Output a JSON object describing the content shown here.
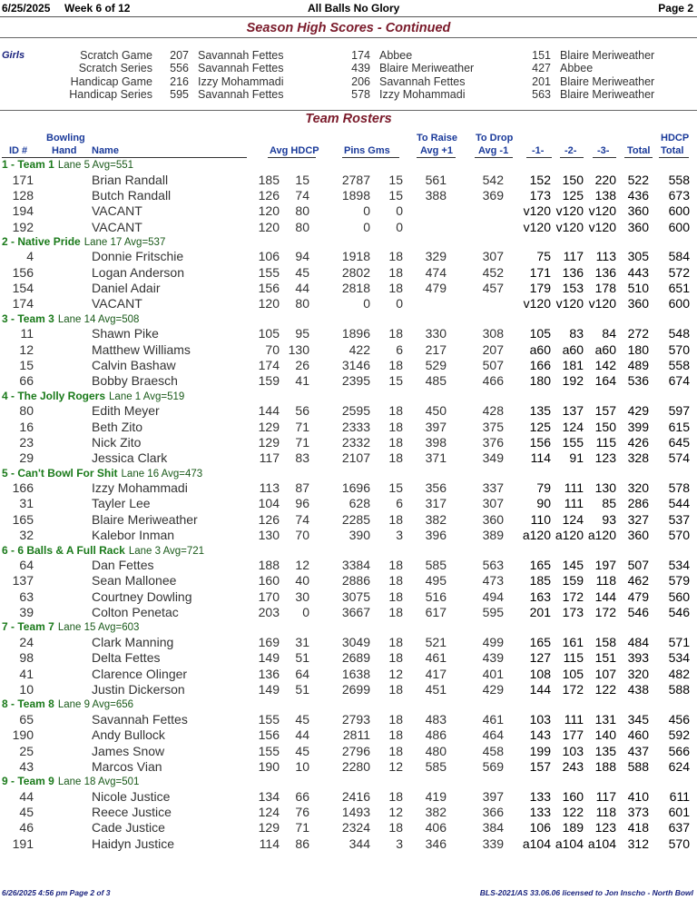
{
  "header": {
    "date": "6/25/2025",
    "week": "Week 6 of 12",
    "league": "All Balls No Glory",
    "page": "Page 2"
  },
  "high_scores": {
    "title": "Season High Scores - Continued",
    "group": "Girls",
    "rows": [
      {
        "label": "Scratch Game",
        "entries": [
          [
            "207",
            "Savannah Fettes"
          ],
          [
            "174",
            "Abbee"
          ],
          [
            "151",
            "Blaire Meriweather"
          ]
        ]
      },
      {
        "label": "Scratch Series",
        "entries": [
          [
            "556",
            "Savannah Fettes"
          ],
          [
            "439",
            "Blaire Meriweather"
          ],
          [
            "427",
            "Abbee"
          ]
        ]
      },
      {
        "label": "Handicap Game",
        "entries": [
          [
            "216",
            "Izzy Mohammadi"
          ],
          [
            "206",
            "Savannah Fettes"
          ],
          [
            "201",
            "Blaire Meriweather"
          ]
        ]
      },
      {
        "label": "Handicap Series",
        "entries": [
          [
            "595",
            "Savannah Fettes"
          ],
          [
            "578",
            "Izzy Mohammadi"
          ],
          [
            "563",
            "Blaire Meriweather"
          ]
        ]
      }
    ]
  },
  "rosters": {
    "title": "Team Rosters",
    "headers": {
      "id": "ID #",
      "bowling": "Bowling",
      "hand": "Hand",
      "name": "Name",
      "avg_hdcp": "Avg HDCP",
      "pins_gms": "Pins Gms",
      "to_raise": "To Raise",
      "avg_plus": "Avg +1",
      "to_drop": "To Drop",
      "avg_minus": "Avg -1",
      "g1": "-1-",
      "g2": "-2-",
      "g3": "-3-",
      "total": "Total",
      "hdcp": "HDCP",
      "hdcp_total": "Total"
    },
    "teams": [
      {
        "name": "1 - Team 1",
        "info": "Lane 5  Avg=551",
        "players": [
          [
            "171",
            "Brian Randall",
            "185",
            "15",
            "2787",
            "15",
            "561",
            "542",
            "152",
            "150",
            "220",
            "522",
            "558"
          ],
          [
            "128",
            "Butch Randall",
            "126",
            "74",
            "1898",
            "15",
            "388",
            "369",
            "173",
            "125",
            "138",
            "436",
            "673"
          ],
          [
            "194",
            "VACANT",
            "120",
            "80",
            "0",
            "0",
            "",
            "",
            "v120",
            "v120",
            "v120",
            "360",
            "600"
          ],
          [
            "192",
            "VACANT",
            "120",
            "80",
            "0",
            "0",
            "",
            "",
            "v120",
            "v120",
            "v120",
            "360",
            "600"
          ]
        ]
      },
      {
        "name": "2 - Native Pride",
        "info": "Lane 17  Avg=537",
        "players": [
          [
            "4",
            "Donnie Fritschie",
            "106",
            "94",
            "1918",
            "18",
            "329",
            "307",
            "75",
            "117",
            "113",
            "305",
            "584"
          ],
          [
            "156",
            "Logan Anderson",
            "155",
            "45",
            "2802",
            "18",
            "474",
            "452",
            "171",
            "136",
            "136",
            "443",
            "572"
          ],
          [
            "154",
            "Daniel Adair",
            "156",
            "44",
            "2818",
            "18",
            "479",
            "457",
            "179",
            "153",
            "178",
            "510",
            "651"
          ],
          [
            "174",
            "VACANT",
            "120",
            "80",
            "0",
            "0",
            "",
            "",
            "v120",
            "v120",
            "v120",
            "360",
            "600"
          ]
        ]
      },
      {
        "name": "3 - Team 3",
        "info": "Lane 14  Avg=508",
        "players": [
          [
            "11",
            "Shawn Pike",
            "105",
            "95",
            "1896",
            "18",
            "330",
            "308",
            "105",
            "83",
            "84",
            "272",
            "548"
          ],
          [
            "12",
            "Matthew Williams",
            "70",
            "130",
            "422",
            "6",
            "217",
            "207",
            "a60",
            "a60",
            "a60",
            "180",
            "570"
          ],
          [
            "15",
            "Calvin Bashaw",
            "174",
            "26",
            "3146",
            "18",
            "529",
            "507",
            "166",
            "181",
            "142",
            "489",
            "558"
          ],
          [
            "66",
            "Bobby Braesch",
            "159",
            "41",
            "2395",
            "15",
            "485",
            "466",
            "180",
            "192",
            "164",
            "536",
            "674"
          ]
        ]
      },
      {
        "name": "4 - The Jolly Rogers",
        "info": "Lane 1  Avg=519",
        "players": [
          [
            "80",
            "Edith Meyer",
            "144",
            "56",
            "2595",
            "18",
            "450",
            "428",
            "135",
            "137",
            "157",
            "429",
            "597"
          ],
          [
            "16",
            "Beth Zito",
            "129",
            "71",
            "2333",
            "18",
            "397",
            "375",
            "125",
            "124",
            "150",
            "399",
            "615"
          ],
          [
            "23",
            "Nick Zito",
            "129",
            "71",
            "2332",
            "18",
            "398",
            "376",
            "156",
            "155",
            "115",
            "426",
            "645"
          ],
          [
            "29",
            "Jessica Clark",
            "117",
            "83",
            "2107",
            "18",
            "371",
            "349",
            "114",
            "91",
            "123",
            "328",
            "574"
          ]
        ]
      },
      {
        "name": "5 - Can't Bowl For Shit",
        "info": "Lane 16  Avg=473",
        "players": [
          [
            "166",
            "Izzy Mohammadi",
            "113",
            "87",
            "1696",
            "15",
            "356",
            "337",
            "79",
            "111",
            "130",
            "320",
            "578"
          ],
          [
            "31",
            "Tayler Lee",
            "104",
            "96",
            "628",
            "6",
            "317",
            "307",
            "90",
            "111",
            "85",
            "286",
            "544"
          ],
          [
            "165",
            "Blaire Meriweather",
            "126",
            "74",
            "2285",
            "18",
            "382",
            "360",
            "110",
            "124",
            "93",
            "327",
            "537"
          ],
          [
            "32",
            "Kalebor Inman",
            "130",
            "70",
            "390",
            "3",
            "396",
            "389",
            "a120",
            "a120",
            "a120",
            "360",
            "570"
          ]
        ]
      },
      {
        "name": "6 - 6 Balls & A Full Rack",
        "info": "Lane 3  Avg=721",
        "players": [
          [
            "64",
            "Dan Fettes",
            "188",
            "12",
            "3384",
            "18",
            "585",
            "563",
            "165",
            "145",
            "197",
            "507",
            "534"
          ],
          [
            "137",
            "Sean Mallonee",
            "160",
            "40",
            "2886",
            "18",
            "495",
            "473",
            "185",
            "159",
            "118",
            "462",
            "579"
          ],
          [
            "63",
            "Courtney Dowling",
            "170",
            "30",
            "3075",
            "18",
            "516",
            "494",
            "163",
            "172",
            "144",
            "479",
            "560"
          ],
          [
            "39",
            "Colton Penetac",
            "203",
            "0",
            "3667",
            "18",
            "617",
            "595",
            "201",
            "173",
            "172",
            "546",
            "546"
          ]
        ]
      },
      {
        "name": "7 - Team 7",
        "info": "Lane 15  Avg=603",
        "players": [
          [
            "24",
            "Clark Manning",
            "169",
            "31",
            "3049",
            "18",
            "521",
            "499",
            "165",
            "161",
            "158",
            "484",
            "571"
          ],
          [
            "98",
            "Delta Fettes",
            "149",
            "51",
            "2689",
            "18",
            "461",
            "439",
            "127",
            "115",
            "151",
            "393",
            "534"
          ],
          [
            "41",
            "Clarence Olinger",
            "136",
            "64",
            "1638",
            "12",
            "417",
            "401",
            "108",
            "105",
            "107",
            "320",
            "482"
          ],
          [
            "10",
            "Justin Dickerson",
            "149",
            "51",
            "2699",
            "18",
            "451",
            "429",
            "144",
            "172",
            "122",
            "438",
            "588"
          ]
        ]
      },
      {
        "name": "8 - Team 8",
        "info": "Lane 9  Avg=656",
        "players": [
          [
            "65",
            "Savannah Fettes",
            "155",
            "45",
            "2793",
            "18",
            "483",
            "461",
            "103",
            "111",
            "131",
            "345",
            "456"
          ],
          [
            "190",
            "Andy Bullock",
            "156",
            "44",
            "2811",
            "18",
            "486",
            "464",
            "143",
            "177",
            "140",
            "460",
            "592"
          ],
          [
            "25",
            "James Snow",
            "155",
            "45",
            "2796",
            "18",
            "480",
            "458",
            "199",
            "103",
            "135",
            "437",
            "566"
          ],
          [
            "43",
            "Marcos Vian",
            "190",
            "10",
            "2280",
            "12",
            "585",
            "569",
            "157",
            "243",
            "188",
            "588",
            "624"
          ]
        ]
      },
      {
        "name": "9 - Team 9",
        "info": "Lane 18  Avg=501",
        "players": [
          [
            "44",
            "Nicole Justice",
            "134",
            "66",
            "2416",
            "18",
            "419",
            "397",
            "133",
            "160",
            "117",
            "410",
            "611"
          ],
          [
            "45",
            "Reece Justice",
            "124",
            "76",
            "1493",
            "12",
            "382",
            "366",
            "133",
            "122",
            "118",
            "373",
            "601"
          ],
          [
            "46",
            "Cade Justice",
            "129",
            "71",
            "2324",
            "18",
            "406",
            "384",
            "106",
            "189",
            "123",
            "418",
            "637"
          ],
          [
            "191",
            "Haidyn Justice",
            "114",
            "86",
            "344",
            "3",
            "346",
            "339",
            "a104",
            "a104",
            "a104",
            "312",
            "570"
          ]
        ]
      }
    ]
  },
  "footer": {
    "left": "6/26/2025  4:56 pm  Page 2 of 3",
    "right": "BLS-2021/AS 33.06.06 licensed to Jon Inscho - North Bowl"
  }
}
